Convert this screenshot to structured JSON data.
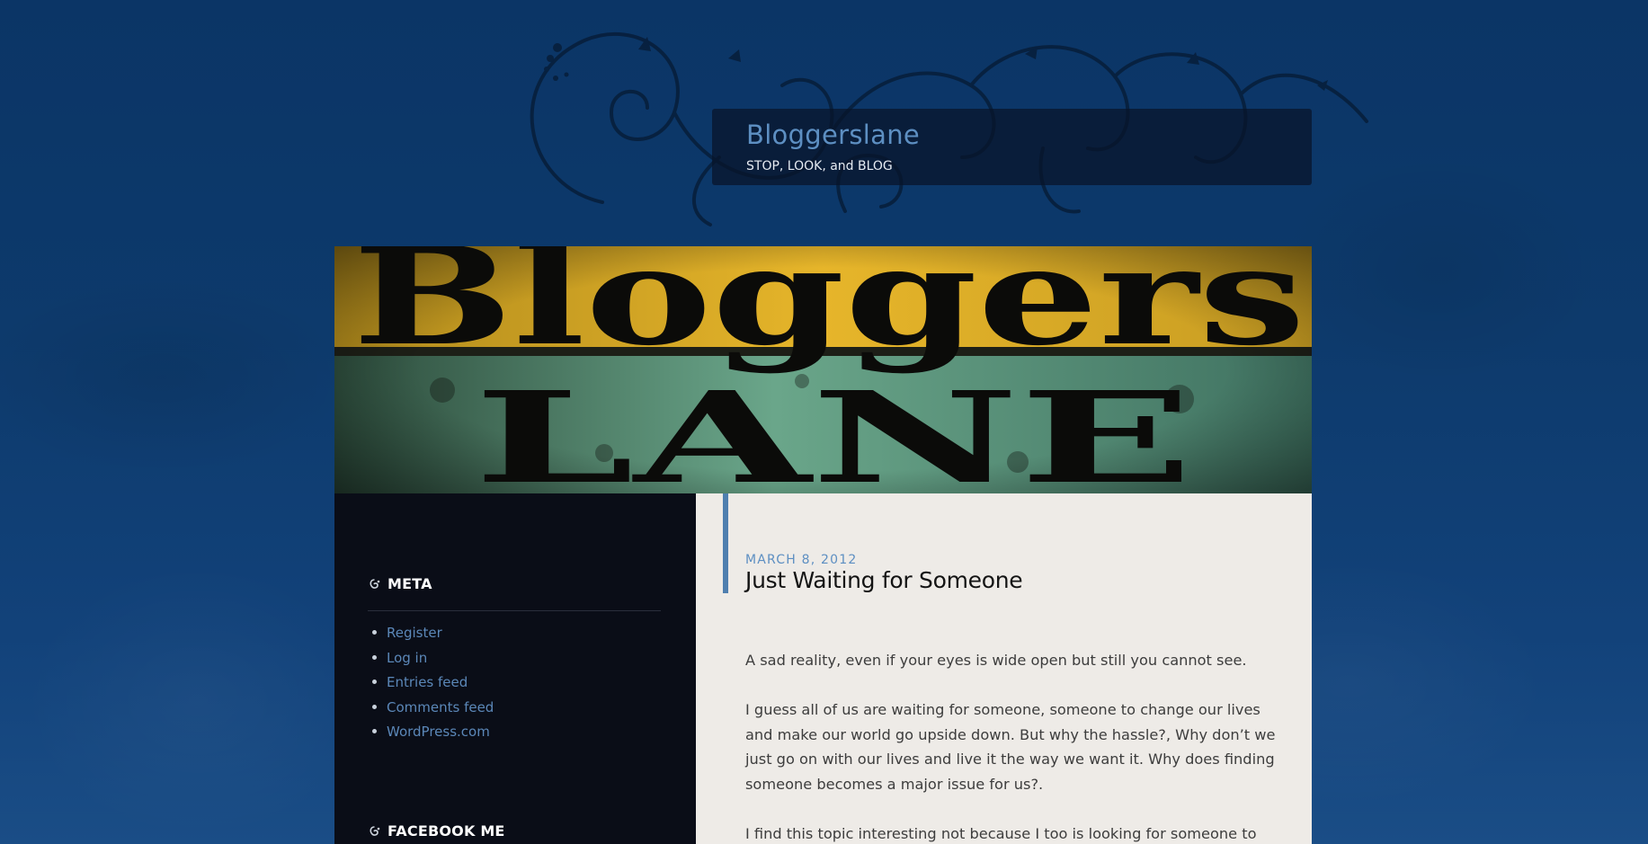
{
  "site": {
    "title": "Bloggerslane",
    "tagline": "STOP, LOOK, and BLOG"
  },
  "banner": {
    "top_word": "Bloggers",
    "bottom_word": "LANE"
  },
  "sidebar": {
    "meta_widget": {
      "title": "META",
      "icon": "swirl-bullet-icon",
      "links": [
        "Register",
        "Log in",
        "Entries feed",
        "Comments feed",
        "WordPress.com"
      ]
    },
    "facebook_widget": {
      "title": "FACEBOOK ME",
      "icon": "swirl-bullet-icon"
    }
  },
  "post": {
    "date": "MARCH 8, 2012",
    "title": "Just Waiting for Someone",
    "paragraphs": [
      "A sad reality, even if your eyes is wide open but still you cannot see.",
      "I guess all of us are waiting for someone, someone to change our lives and make our world go upside down. But why the hassle?, Why don’t we just go on with our lives and live it  the way we want it. Why does finding someone becomes a major issue for us?.",
      "I find this topic interesting not because I too is looking for someone to"
    ]
  },
  "colors": {
    "background": "#0d3a6c",
    "link": "#5b87b8",
    "accent": "#4f7faf",
    "sidebar_bg": "#0a0d17",
    "content_bg": "#eeebe7",
    "banner_yellow": "#e2b22a",
    "banner_green": "#5f9c80"
  }
}
